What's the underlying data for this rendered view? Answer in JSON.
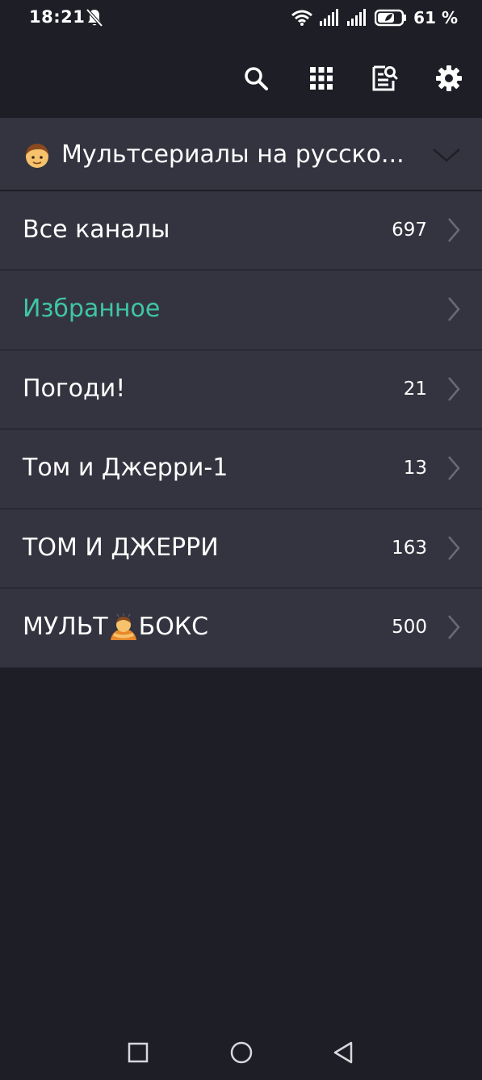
{
  "status_bar": {
    "time": "18:21",
    "battery_percent": "61 %",
    "icons": [
      "bell-off-icon",
      "wifi-icon",
      "signal-icon",
      "signal-icon",
      "battery-icon"
    ]
  },
  "toolbar": {
    "icons": [
      "search-icon",
      "grid-icon",
      "epg-icon",
      "gear-icon"
    ]
  },
  "group": {
    "emoji": "boy-emoji",
    "title": "Мультсериалы на русско..."
  },
  "rows": [
    {
      "label": "Все каналы",
      "count": "697"
    },
    {
      "label": "Избранное",
      "count": ""
    },
    {
      "label": "Погоди!",
      "count": "21"
    },
    {
      "label": "Том и Джерри-1",
      "count": "13"
    },
    {
      "label": "ТОМ И ДЖЕРРИ",
      "count": "163"
    },
    {
      "label_part1": "МУЛЬТ",
      "label_emoji": "person-bowing-emoji",
      "label_part2": "БОКС",
      "count": "500"
    }
  ],
  "colors": {
    "background": "#1e1e27",
    "row_background": "#343440",
    "accent": "#3fc6a4",
    "text": "#ffffff",
    "chevron": "#6a6a76"
  },
  "navbar": {
    "icons": [
      "recent-apps-icon",
      "home-icon",
      "back-icon"
    ]
  }
}
